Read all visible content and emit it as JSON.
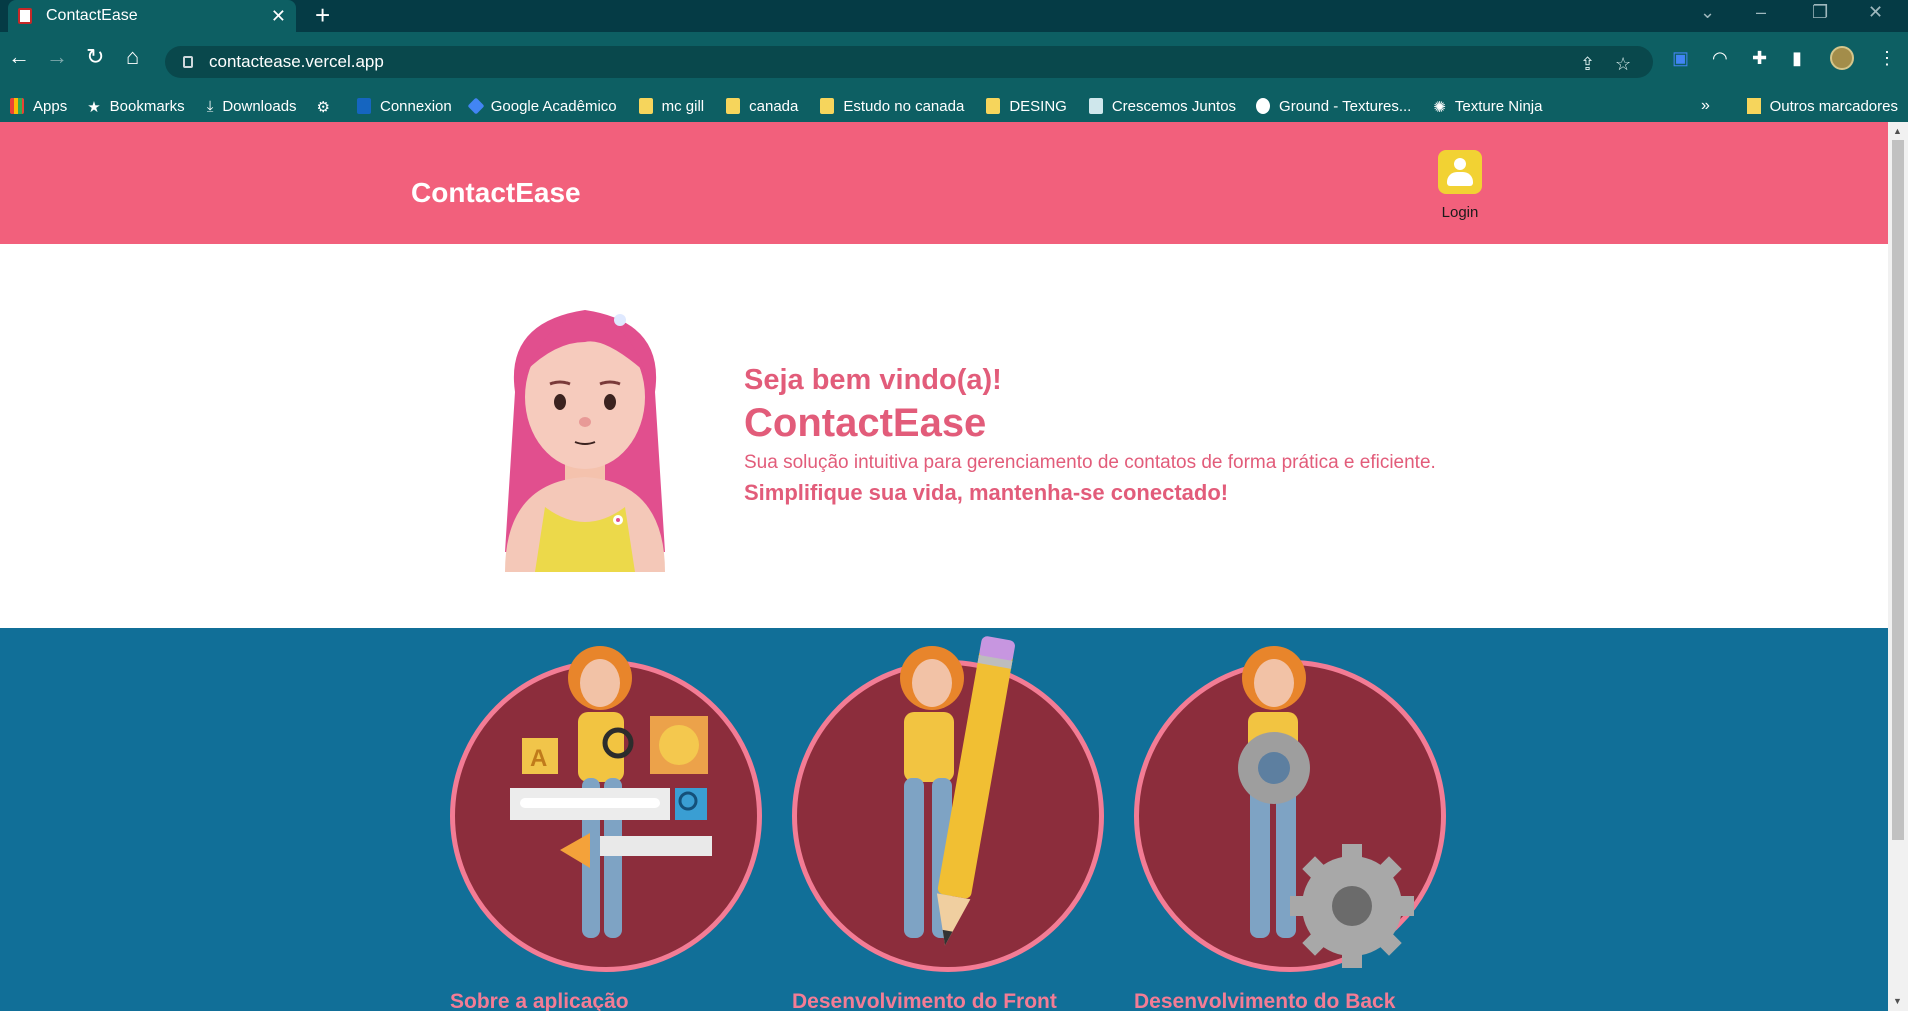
{
  "browser": {
    "tab_title": "ContactEase",
    "url": "contactease.vercel.app",
    "bookmarks": [
      "Apps",
      "Bookmarks",
      "Downloads",
      "Connexion",
      "Google Acadêmico",
      "mc gill",
      "canada",
      "Estudo no canada",
      "DESING",
      "Crescemos Juntos",
      "Ground - Textures...",
      "Texture Ninja"
    ],
    "other_bookmarks": "Outros marcadores",
    "more": "»"
  },
  "header": {
    "brand": "ContactEase",
    "login_label": "Login"
  },
  "hero": {
    "greeting": "Seja bem vindo(a)!",
    "title": "ContactEase",
    "description": "Sua solução intuitiva para gerenciamento de contatos de forma prática e eficiente.",
    "slogan": "Simplifique sua vida, mantenha-se conectado!"
  },
  "features": [
    {
      "title": "Sobre a aplicação"
    },
    {
      "title": "Desenvolvimento do Front"
    },
    {
      "title": "Desenvolvimento do Back"
    }
  ],
  "colors": {
    "header": "#f2607c",
    "accent_text": "#e25c7a",
    "features_bg": "#116f98",
    "circle_fill": "#8c2d3c",
    "circle_border": "#f37c95"
  }
}
